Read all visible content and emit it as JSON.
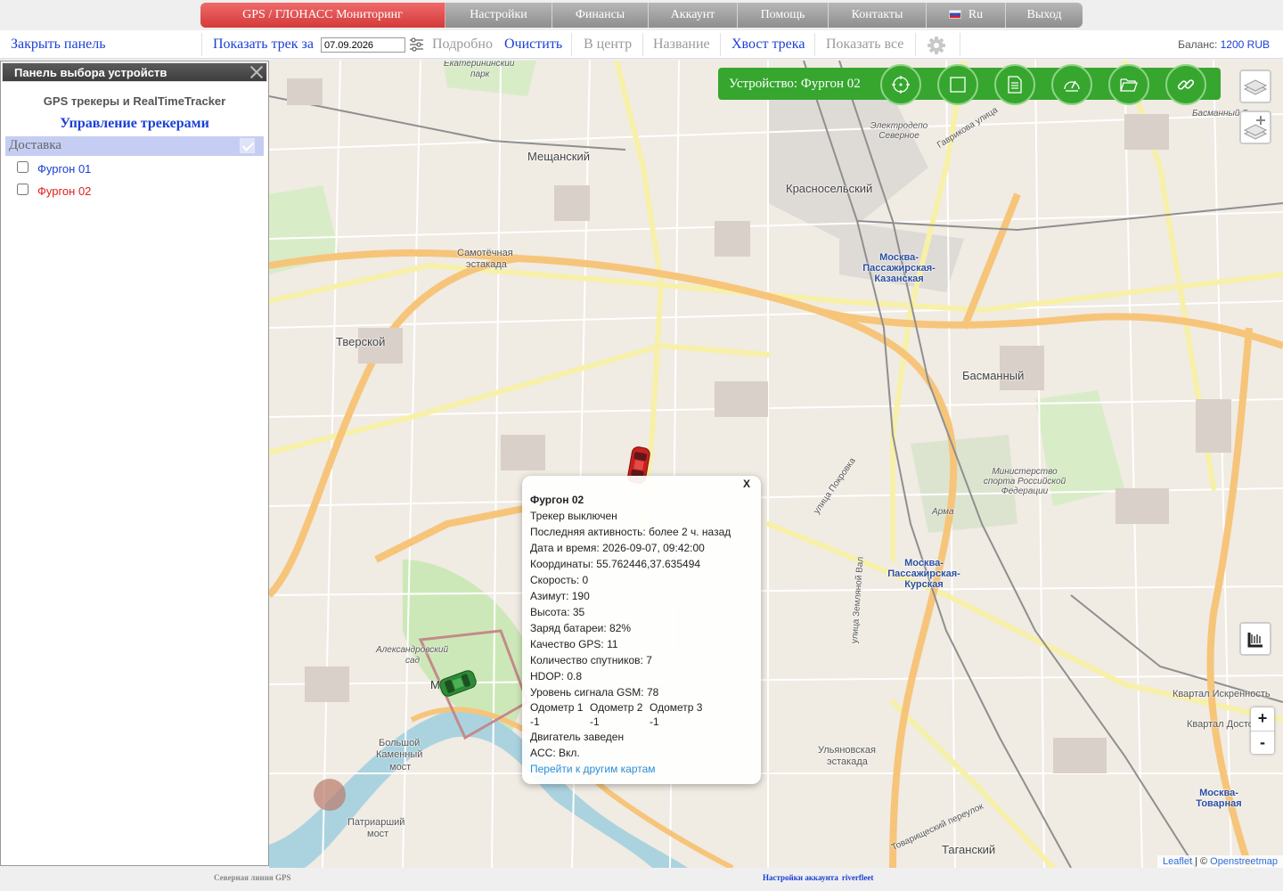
{
  "menu": {
    "brand": "GPS / ГЛОНАСС Мониторинг",
    "items": [
      "Настройки",
      "Финансы",
      "Аккаунт",
      "Помощь",
      "Контакты"
    ],
    "language": "Ru",
    "logout": "Выход"
  },
  "toolbar": {
    "close_panel": "Закрыть панель",
    "show_track": "Показать трек за",
    "date": "07.09.2026",
    "details": "Подробно",
    "clear": "Очистить",
    "center": "В центр",
    "name": "Название",
    "track_tail": "Хвост трека",
    "show_all": "Показать все",
    "balance_label": "Баланс:",
    "balance_value": "1200 RUB"
  },
  "panel": {
    "title": "Панель выбора устройств",
    "subtitle": "GPS трекеры и RealTimeTracker",
    "heading": "Управление трекерами",
    "group": "Доставка",
    "devices": [
      {
        "name": "Фургон 01",
        "color": "#1a3fd6"
      },
      {
        "name": "Фургон 02",
        "color": "#e0201b"
      }
    ]
  },
  "device_bar": {
    "label": "Устройство: Фургон 02",
    "icons": [
      "target-icon",
      "square-icon",
      "document-icon",
      "speedometer-icon",
      "folder-icon",
      "link-icon"
    ]
  },
  "popup": {
    "close": "X",
    "title": "Фургон 02",
    "status": "Трекер выключен",
    "last_activity": "Последняя активность: более 2 ч. назад",
    "datetime": "Дата и время: 2026-09-07, 09:42:00",
    "coords": "Координаты: 55.762446,37.635494",
    "speed": "Скорость: 0",
    "azimuth": "Азимут: 190",
    "altitude": "Высота: 35",
    "battery": "Заряд батареи: 82%",
    "gps_quality": "Качество GPS: 11",
    "satellites": "Количество спутников: 7",
    "hdop": "HDOP: 0.8",
    "gsm": "Уровень сигнала GSM: 78",
    "odometer_labels": [
      "Одометр 1",
      "Одометр 2",
      "Одометр 3"
    ],
    "odometer_values": [
      "-1",
      "-1",
      "-1"
    ],
    "engine": "Двигатель заведен",
    "acc": "ACC: Вкл.",
    "link": "Перейти к другим картам"
  },
  "map": {
    "labels": {
      "meshchansky": "Мещанский",
      "krasnoselsky": "Красносельский",
      "tverskoy": "Тверской",
      "basmanny": "Басманный",
      "basmanny_ra": "Басманный Ра",
      "samotechnaya": "Самотёчная",
      "estakada": "эстакада",
      "ulyanovskaya": "Ульяновская",
      "estakada2": "эстакада",
      "bolshoy": "Большой",
      "kamenny": "Каменный",
      "most": "мост",
      "patriarshy": "Патриарший",
      "most2": "мост",
      "taganskiy": "Таганский",
      "kvartal_iskrennost": "Квартал Искренность",
      "kvartal_dost": "Квартал Досто",
      "ekaterininsky": "Екатерининский",
      "park": "парк",
      "alexandrovsky": "Александровский",
      "sad": "сад",
      "gavrikova": "Гаврикова улица",
      "pokrovka": "улица Покровка",
      "zemlyanoy": "улица Земляной Вал",
      "tovarishchesky": "Товарищеский переулок",
      "ministry": "Министерство спорта Российской Федерации",
      "kazanskaya1": "Москва-",
      "kazanskaya2": "Пассажирская-",
      "kazanskaya3": "Казанская",
      "kurskaya1": "Москва-",
      "kurskaya2": "Пассажирская-",
      "kurskaya3": "Курская",
      "tovarnaya1": "Москва-",
      "tovarnaya2": "Товарная",
      "arma": "Арма",
      "elektrodepo": "Электродепо Северное",
      "moskva": "Москва"
    },
    "attribution_leaflet": "Leaflet",
    "attribution_sep": " | © ",
    "attribution_osm": "Openstreetmap"
  },
  "footer": {
    "left": "Северная линия GPS",
    "right_label": "Настройки аккаунта",
    "right_user": "riverfleet"
  }
}
